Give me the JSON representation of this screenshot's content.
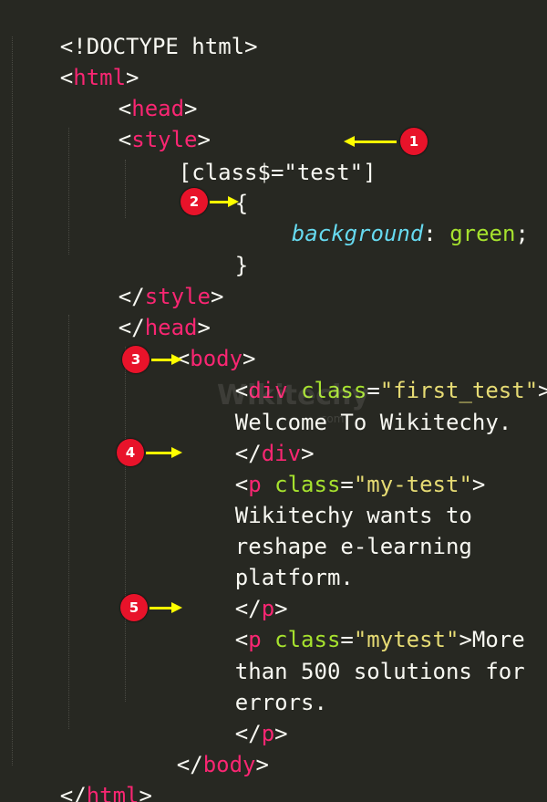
{
  "code": {
    "doctype": "<!DOCTYPE html>",
    "lt": "<",
    "gt": ">",
    "lt_slash": "</",
    "html_tag": "html",
    "head_tag": "head",
    "style_tag": "style",
    "body_tag": "body",
    "div_tag": "div",
    "p_tag": "p",
    "selector": "[class$=\"test\"]",
    "open_brace": "{",
    "close_brace": "}",
    "property": "background",
    "colon": ": ",
    "value": "green",
    "semicolon": ";",
    "class_attr": "class",
    "eq": "=",
    "div_class_value": "\"first_test\"",
    "div_text": "Welcome To Wikitechy.",
    "p1_class_value": "\"my-test\"",
    "p1_text_line1": "Wikitechy wants to",
    "p1_text_line2": "reshape e-learning",
    "p1_text_line3": "platform.",
    "p2_class_value": "\"mytest\"",
    "p2_text_line1": "More",
    "p2_text_line2": "than 500 solutions for",
    "p2_text_line3": "errors."
  },
  "annotations": [
    "1",
    "2",
    "3",
    "4",
    "5"
  ],
  "watermark": {
    "main": "Wikitechy",
    "sub": ".com"
  },
  "colors": {
    "background": "#272822",
    "tag": "#f92672",
    "attribute": "#a6e22e",
    "string": "#e6db74",
    "property": "#66d9ef",
    "badge": "#e8132a",
    "arrow": "#ffff00"
  }
}
